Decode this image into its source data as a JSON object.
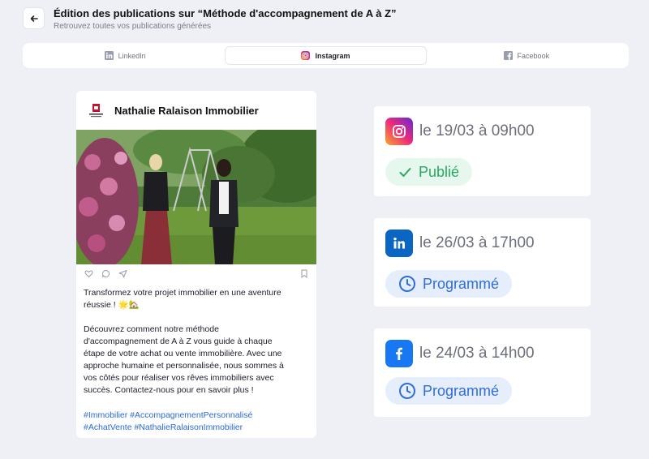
{
  "header": {
    "title": "Édition des publications sur “Méthode d'accompagnement de A à Z”",
    "subtitle": "Retrouvez toutes vos publications générées"
  },
  "tabs": [
    {
      "label": "LinkedIn",
      "icon": "linkedin-icon",
      "active": false
    },
    {
      "label": "Instagram",
      "icon": "instagram-icon",
      "active": true
    },
    {
      "label": "Facebook",
      "icon": "facebook-icon",
      "active": false
    }
  ],
  "post": {
    "author": "Nathalie Ralaison Immobilier",
    "paragraph_1": "Transformez votre projet immobilier en une aventure\nréussie ! 🌟🏡",
    "paragraph_2": "Découvrez comment notre méthode\nd'accompagnement de A à Z vous guide à chaque\nétape de votre achat ou vente immobilière. Avec une\napproche humaine et personnalisée, nous sommes à\nvos côtés pour réaliser vos rêves immobiliers avec\nsuccès. Contactez-nous pour en savoir plus !",
    "hashtags": "#Immobilier #AccompagnementPersonnalisé\n#AchatVente #NathalieRalaisonImmobilier"
  },
  "schedules": [
    {
      "network": "instagram-icon",
      "date": "le 19/03 à 09h00",
      "status": "Publié",
      "status_type": "published"
    },
    {
      "network": "linkedin-icon",
      "date": "le 26/03 à 17h00",
      "status": "Programmé",
      "status_type": "scheduled"
    },
    {
      "network": "facebook-icon",
      "date": "le 24/03 à 14h00",
      "status": "Programmé",
      "status_type": "scheduled"
    }
  ],
  "colors": {
    "background": "#eef0f6",
    "linkedin": "#0a66c2",
    "facebook": "#1877f2",
    "published": "#2aa864",
    "scheduled": "#2f6ed6"
  }
}
